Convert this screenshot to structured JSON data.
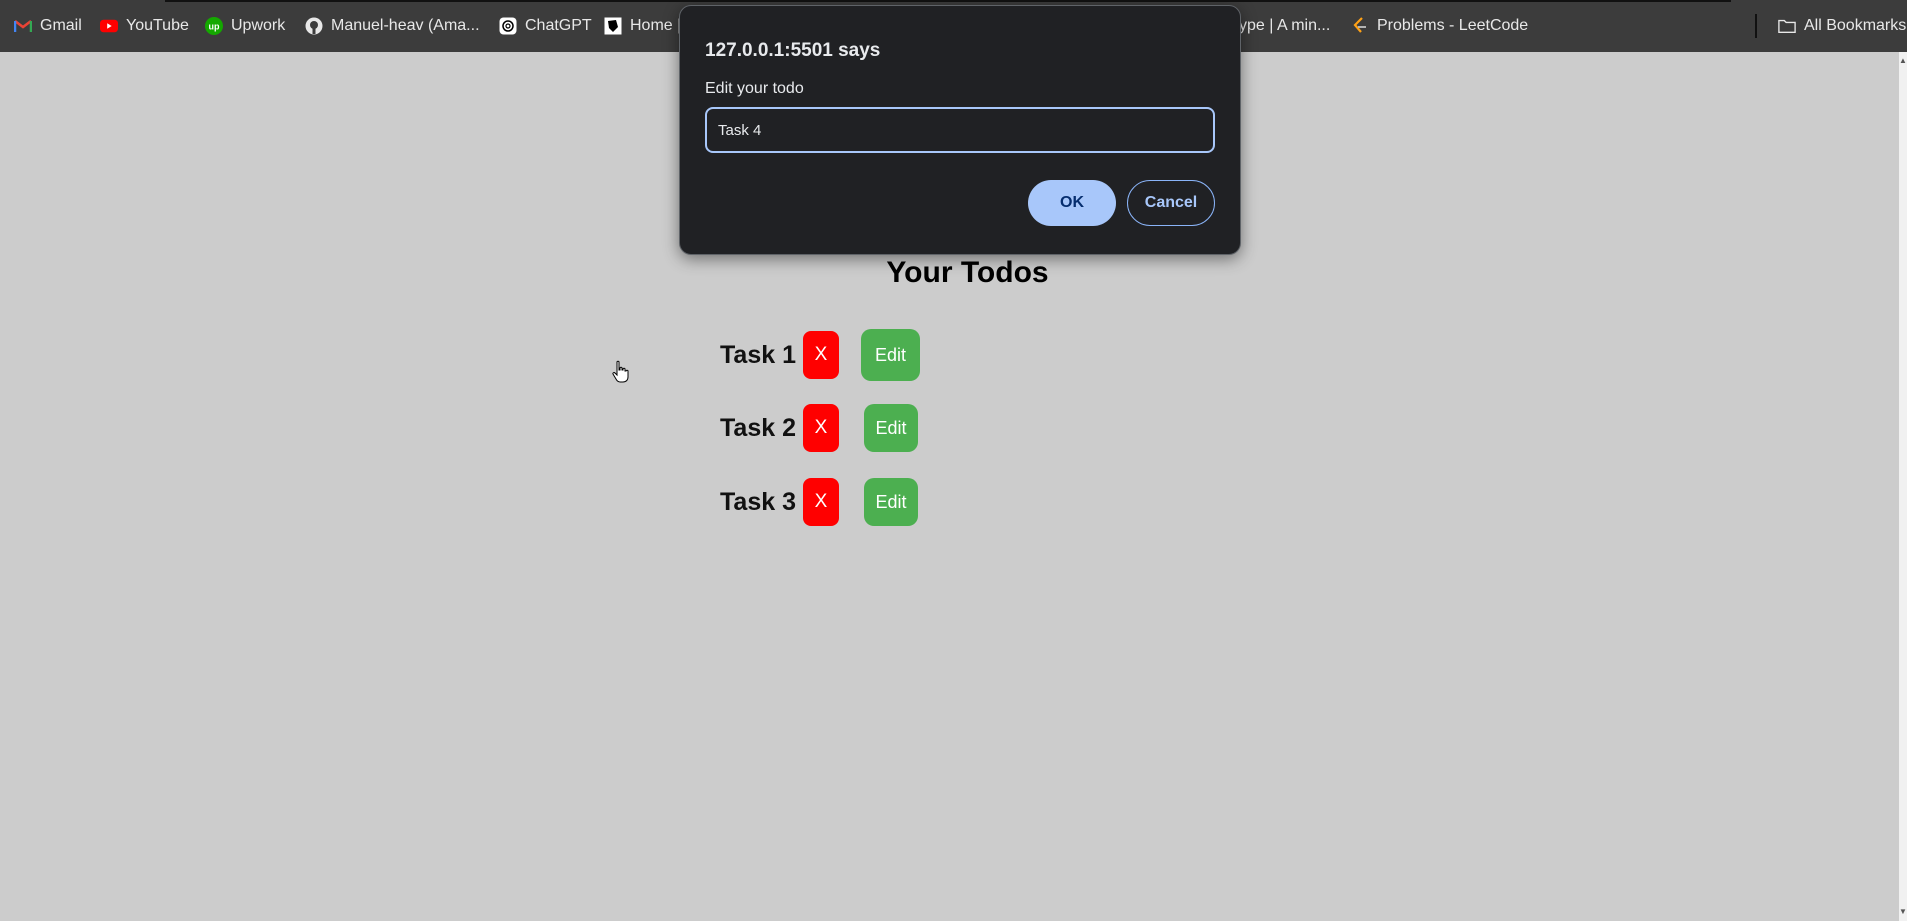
{
  "bookmarks": [
    {
      "label": "Gmail",
      "icon": "gmail-icon"
    },
    {
      "label": "YouTube",
      "icon": "youtube-icon"
    },
    {
      "label": "Upwork",
      "icon": "upwork-icon"
    },
    {
      "label": "Manuel-heav (Ama...",
      "icon": "github-icon"
    },
    {
      "label": "ChatGPT",
      "icon": "chatgpt-icon"
    },
    {
      "label": "Home |",
      "icon": "home-icon"
    },
    {
      "label": "ype | A min...",
      "icon": ""
    },
    {
      "label": "Problems - LeetCode",
      "icon": "leetcode-icon"
    }
  ],
  "all_bookmarks_label": "All Bookmarks",
  "page": {
    "heading": "Your Todos",
    "todos": [
      {
        "label": "Task 1",
        "delete_label": "X",
        "edit_label": "Edit"
      },
      {
        "label": "Task 2",
        "delete_label": "X",
        "edit_label": "Edit"
      },
      {
        "label": "Task 3",
        "delete_label": "X",
        "edit_label": "Edit"
      }
    ]
  },
  "dialog": {
    "title": "127.0.0.1:5501 says",
    "message": "Edit your todo",
    "input_value": "Task 4",
    "ok_label": "OK",
    "cancel_label": "Cancel"
  },
  "colors": {
    "page_background": "#cccccc",
    "bookmarks_bar": "#3c3c3c",
    "delete_button": "#ff0000",
    "edit_button": "#4caf50",
    "dialog_background": "#202124",
    "dialog_accent": "#a8c7fa"
  }
}
